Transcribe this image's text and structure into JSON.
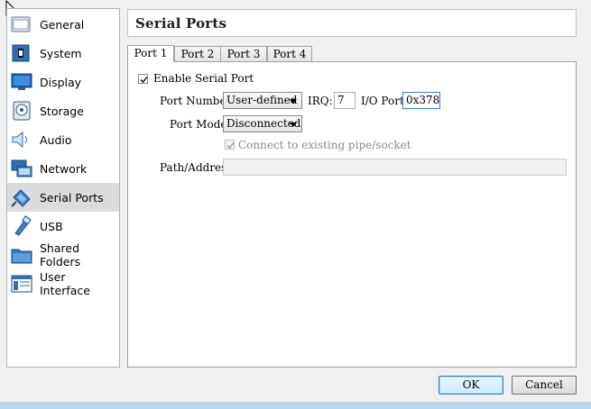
{
  "sidebar": {
    "items": [
      {
        "label": "General",
        "icon": "general-icon"
      },
      {
        "label": "System",
        "icon": "system-chip-icon"
      },
      {
        "label": "Display",
        "icon": "monitor-icon"
      },
      {
        "label": "Storage",
        "icon": "disk-icon"
      },
      {
        "label": "Audio",
        "icon": "speaker-icon"
      },
      {
        "label": "Network",
        "icon": "network-icon"
      },
      {
        "label": "Serial Ports",
        "icon": "serial-port-icon",
        "selected": true
      },
      {
        "label": "USB",
        "icon": "usb-icon"
      },
      {
        "label": "Shared Folders",
        "icon": "folder-icon"
      },
      {
        "label": "User Interface",
        "icon": "user-interface-icon"
      }
    ]
  },
  "header": {
    "title": "Serial Ports"
  },
  "tabs": [
    {
      "label": "Port 1",
      "active": true
    },
    {
      "label": "Port 2"
    },
    {
      "label": "Port 3"
    },
    {
      "label": "Port 4"
    }
  ],
  "form": {
    "enable_label": "Enable Serial Port",
    "enable_checked": true,
    "port_number_label": "Port Number:",
    "port_number_value": "User-defined",
    "irq_label": "IRQ:",
    "irq_value": "7",
    "io_port_label": "I/O Port:",
    "io_port_value": "0x378",
    "port_mode_label": "Port Mode:",
    "port_mode_value": "Disconnected",
    "connect_label": "Connect to existing pipe/socket",
    "connect_checked": true,
    "connect_disabled": true,
    "path_label": "Path/Address:",
    "path_value": ""
  },
  "buttons": {
    "ok": "OK",
    "cancel": "Cancel"
  }
}
